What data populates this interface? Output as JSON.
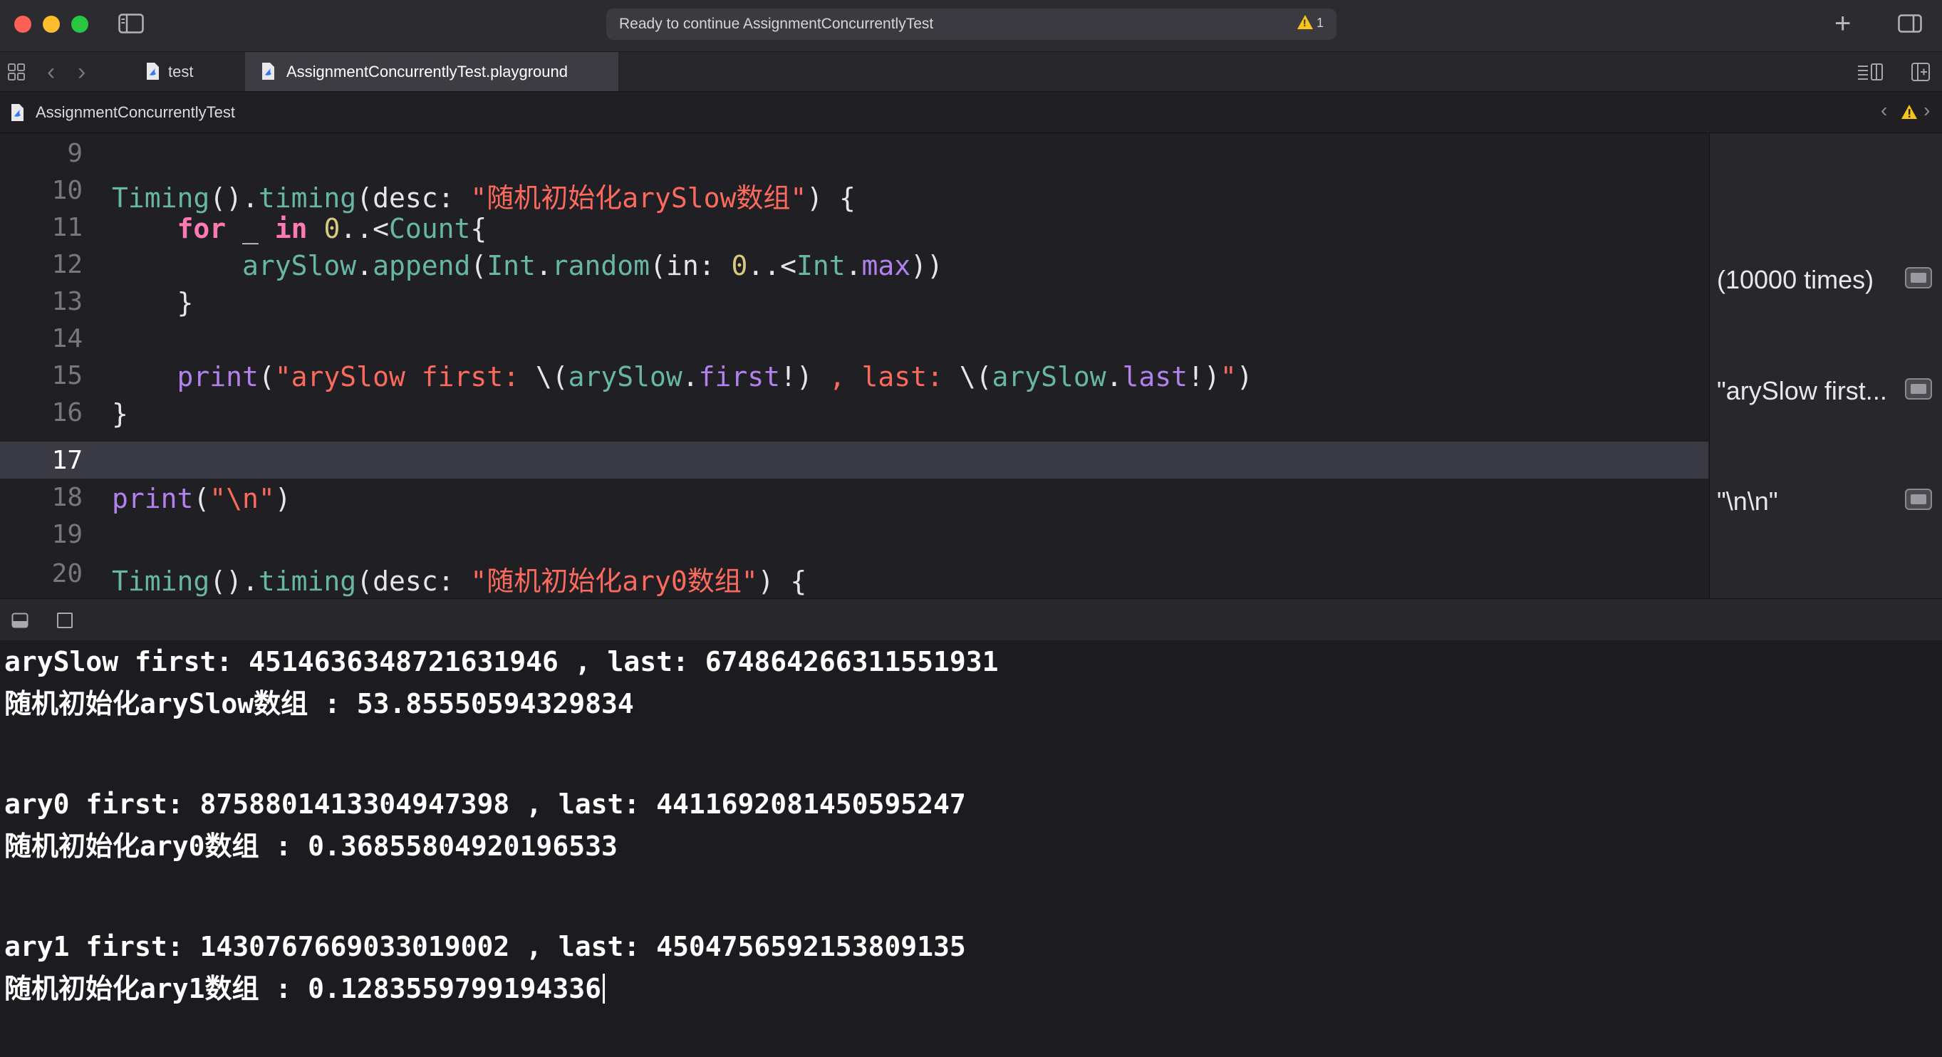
{
  "titlebar": {
    "activity_status": "Ready to continue AssignmentConcurrentlyTest",
    "warning_count": "1",
    "plus_label": "+"
  },
  "tabs": [
    {
      "label": "test",
      "active": false
    },
    {
      "label": "AssignmentConcurrentlyTest.playground",
      "active": true
    }
  ],
  "jumpbar": {
    "path": "AssignmentConcurrentlyTest"
  },
  "editor": {
    "current_line": "17",
    "line_numbers": [
      "9",
      "10",
      "11",
      "12",
      "13",
      "14",
      "15",
      "16",
      "17",
      "18",
      "19",
      "20"
    ],
    "code": {
      "l10_obj": "Timing",
      "l10_paren": "().",
      "l10_fn": "timing",
      "l10_param": "(desc: ",
      "l10_str": "\"随机初始化arySlow数组\"",
      "l10_end": ") {",
      "l11_indent": "    ",
      "l11_kw1": "for",
      "l11_us": " _ ",
      "l11_kw2": "in",
      "l11_sp": " ",
      "l11_num": "0",
      "l11_op": "..<",
      "l11_var": "Count",
      "l11_end": "{",
      "l12_indent": "        ",
      "l12_var": "arySlow",
      "l12_dot": ".",
      "l12_fn": "append",
      "l12_p1": "(",
      "l12_typ": "Int",
      "l12_dot2": ".",
      "l12_fn2": "random",
      "l12_p2": "(in: ",
      "l12_num": "0",
      "l12_op": "..<",
      "l12_typ2": "Int",
      "l12_dot3": ".",
      "l12_prop": "max",
      "l12_end": "))",
      "l13": "    }",
      "l15_indent": "    ",
      "l15_fn": "print",
      "l15_p1": "(",
      "l15_s1": "\"arySlow first: ",
      "l15_i1": "\\(",
      "l15_v1": "arySlow",
      "l15_d1": ".",
      "l15_pr1": "first",
      "l15_c1": "!)",
      "l15_s2": " , last: ",
      "l15_i2": "\\(",
      "l15_v2": "arySlow",
      "l15_d2": ".",
      "l15_pr2": "last",
      "l15_c2": "!)",
      "l15_s3": "\"",
      "l15_end": ")",
      "l16": "}",
      "l18_fn": "print",
      "l18_p1": "(",
      "l18_str": "\"\\n\"",
      "l18_end": ")",
      "l20_obj": "Timing",
      "l20_paren": "().",
      "l20_fn": "timing",
      "l20_param": "(desc: ",
      "l20_str": "\"随机初始化ary0数组\"",
      "l20_end": ") {"
    }
  },
  "results": [
    {
      "line": "12",
      "text": "(10000 times)"
    },
    {
      "line": "15",
      "text": "\"arySlow first..."
    },
    {
      "line": "18",
      "text": "\"\\n\\n\""
    }
  ],
  "console": {
    "lines": [
      "arySlow first: 4514636348721631946 , last: 674864266311551931",
      "随机初始化arySlow数组 : 53.85550594329834",
      "",
      "",
      "ary0 first: 8758801413304947398 , last: 4411692081450595247",
      "随机初始化ary0数组 : 0.36855804920196533",
      "",
      "",
      "ary1 first: 1430767669033019002 , last: 4504756592153809135",
      "随机初始化ary1数组 : 0.1283559799194336"
    ]
  }
}
